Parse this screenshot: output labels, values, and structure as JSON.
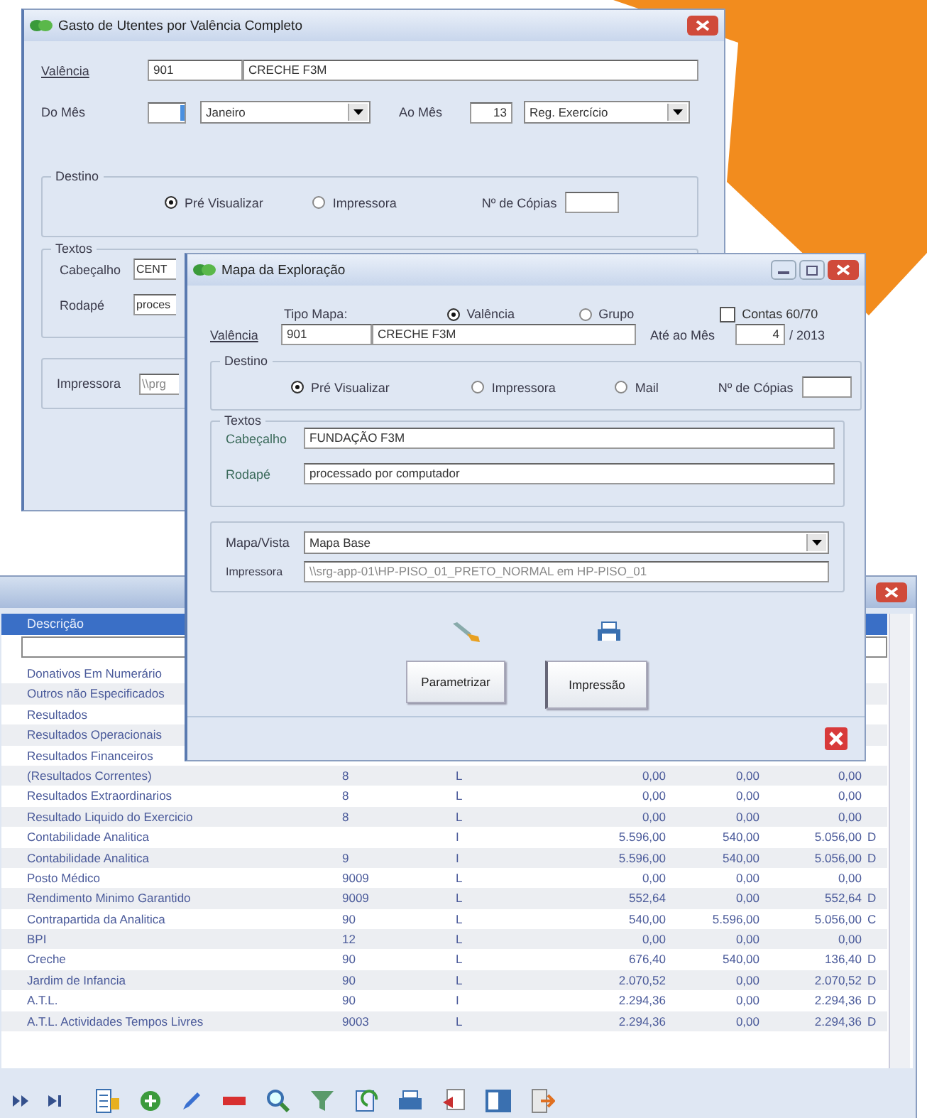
{
  "report_window": {
    "title": "Gasto de Utentes por Valência Completo",
    "valencia_label": "Valência",
    "valencia_code": "901",
    "valencia_name": "CRECHE F3M",
    "from_month_label": "Do Mês",
    "from_month_name": "Janeiro",
    "to_month_label": "Ao Mês",
    "to_month_value": "13",
    "to_month_name": "Reg. Exercício",
    "destination": {
      "title": "Destino",
      "options": [
        {
          "label": "Pré Visualizar",
          "selected": true
        },
        {
          "label": "Impressora",
          "selected": false
        }
      ],
      "copies_label": "Nº de Cópias"
    },
    "texts": {
      "title": "Textos",
      "header_label": "Cabeçalho",
      "header_value": "CENT",
      "footer_label": "Rodapé",
      "footer_value": "proces"
    },
    "printer": {
      "label": "Impressora",
      "value": "\\\\prg"
    }
  },
  "map_window": {
    "title": "Mapa da Exploração",
    "map_type_label": "Tipo Mapa:",
    "map_type_options": [
      {
        "label": "Valência",
        "selected": true
      },
      {
        "label": "Grupo",
        "selected": false
      }
    ],
    "accounts_checkbox": {
      "label": "Contas 60/70",
      "checked": false
    },
    "valencia_label": "Valência",
    "valencia_code": "901",
    "valencia_name": "CRECHE F3M",
    "until_month_label": "Até ao Mês",
    "until_month_value": "4",
    "year": "/ 2013",
    "destination": {
      "title": "Destino",
      "options": [
        {
          "label": "Pré Visualizar",
          "selected": true
        },
        {
          "label": "Impressora",
          "selected": false
        },
        {
          "label": "Mail",
          "selected": false
        }
      ],
      "copies_label": "Nº de Cópias"
    },
    "texts": {
      "title": "Textos",
      "header_label": "Cabeçalho",
      "header_value": "FUNDAÇÃO F3M",
      "footer_label": "Rodapé",
      "footer_value": "processado por computador"
    },
    "view_label": "Mapa/Vista",
    "view_value": "Mapa Base",
    "printer_label": "Impressora",
    "printer_value": "\\\\srg-app-01\\HP-PISO_01_PRETO_NORMAL em HP-PISO_01",
    "buttons": [
      "Parametrizar",
      "Impressão"
    ]
  },
  "ledger_window": {
    "header": "Descrição",
    "rows": [
      {
        "description": "Donativos Em Numerário"
      },
      {
        "description": "Outros não Especificados"
      },
      {
        "description": "Resultados"
      },
      {
        "description": "Resultados Operacionais"
      },
      {
        "description": "Resultados Financeiros"
      },
      {
        "description": "(Resultados Correntes)",
        "code": "8",
        "type": "L",
        "debit": "0,00",
        "credit": "0,00",
        "balance": "0,00"
      },
      {
        "description": "Resultados Extraordinarios",
        "code": "8",
        "type": "L",
        "debit": "0,00",
        "credit": "0,00",
        "balance": "0,00"
      },
      {
        "description": "Resultado Liquido do Exercicio",
        "code": "8",
        "type": "L",
        "debit": "0,00",
        "credit": "0,00",
        "balance": "0,00"
      },
      {
        "description": "Contabilidade Analitica",
        "type": "I",
        "debit": "5.596,00",
        "credit": "540,00",
        "balance": "5.056,00",
        "flag": "D"
      },
      {
        "description": "Contabilidade Analitica",
        "code": "9",
        "type": "I",
        "debit": "5.596,00",
        "credit": "540,00",
        "balance": "5.056,00",
        "flag": "D"
      },
      {
        "description": "Posto Médico",
        "code": "9009",
        "type": "L",
        "debit": "0,00",
        "credit": "0,00",
        "balance": "0,00"
      },
      {
        "description": "Rendimento Minimo Garantido",
        "code": "9009",
        "type": "L",
        "debit": "552,64",
        "credit": "0,00",
        "balance": "552,64",
        "flag": "D"
      },
      {
        "description": "Contrapartida da Analitica",
        "code": "90",
        "type": "L",
        "debit": "540,00",
        "credit": "5.596,00",
        "balance": "5.056,00",
        "flag": "C"
      },
      {
        "description": "BPI",
        "code": "12",
        "type": "L",
        "debit": "0,00",
        "credit": "0,00",
        "balance": "0,00"
      },
      {
        "description": "Creche",
        "code": "90",
        "type": "L",
        "debit": "676,40",
        "credit": "540,00",
        "balance": "136,40",
        "flag": "D"
      },
      {
        "description": "Jardim de Infancia",
        "code": "90",
        "type": "L",
        "debit": "2.070,52",
        "credit": "0,00",
        "balance": "2.070,52",
        "flag": "D"
      },
      {
        "description": "A.T.L.",
        "code": "90",
        "type": "I",
        "debit": "2.294,36",
        "credit": "0,00",
        "balance": "2.294,36",
        "flag": "D"
      },
      {
        "description": "A.T.L. Actividades Tempos Livres",
        "code": "9003",
        "type": "L",
        "debit": "2.294,36",
        "credit": "0,00",
        "balance": "2.294,36",
        "flag": "D"
      }
    ]
  }
}
